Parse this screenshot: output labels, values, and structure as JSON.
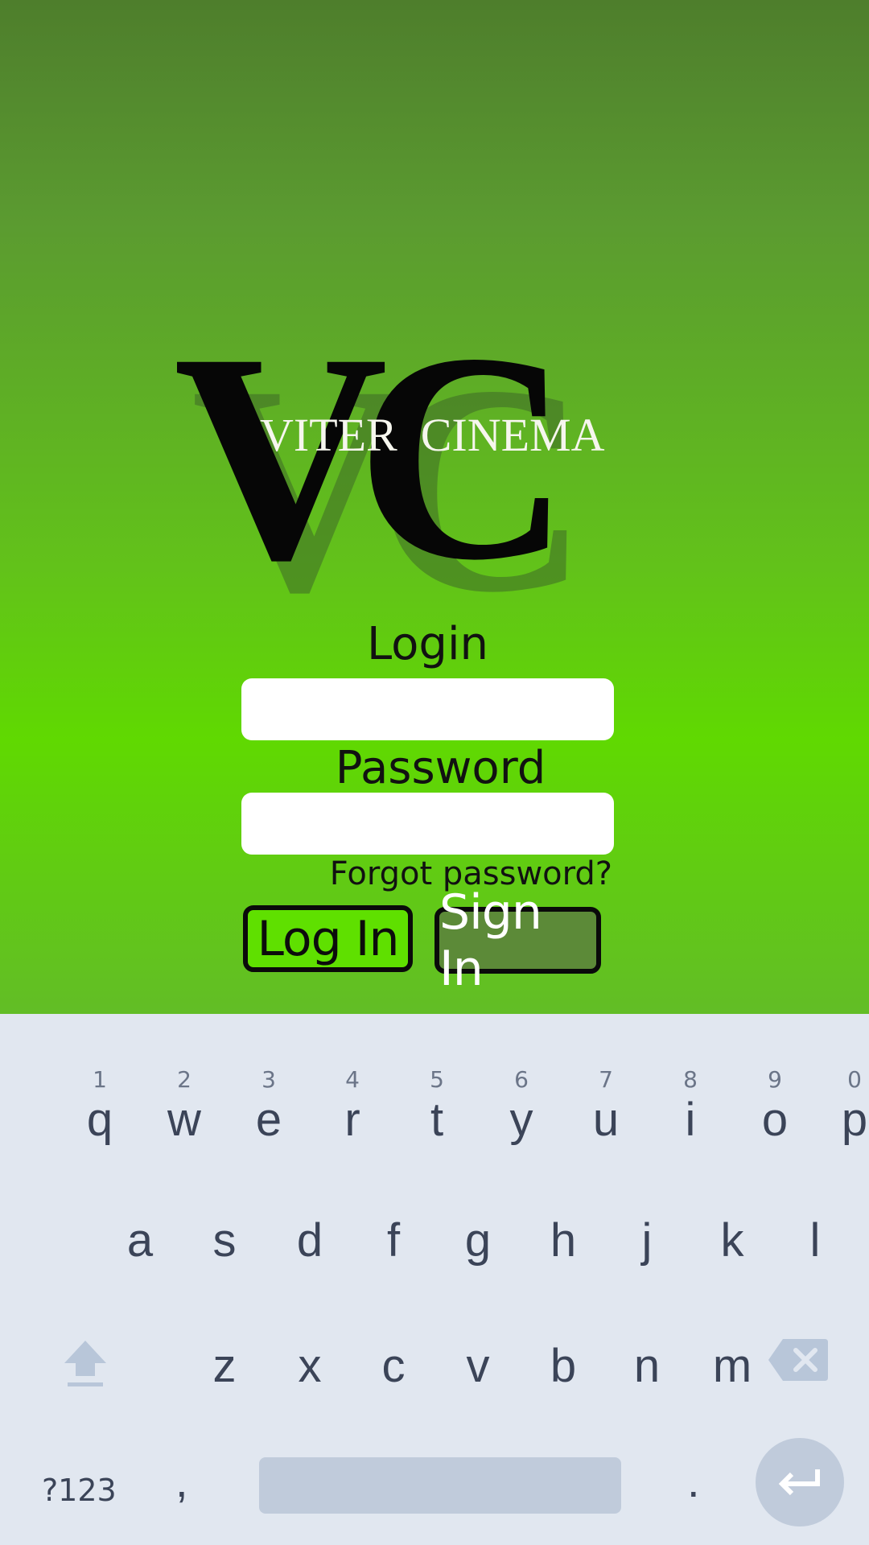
{
  "brand": {
    "monogram": "VC",
    "name": "VITER  CINEMA"
  },
  "form": {
    "login_label": "Login",
    "login_value": "",
    "password_label": "Password",
    "password_value": "",
    "forgot_label": "Forgot password?",
    "login_button": "Log In",
    "signin_button": "Sign In"
  },
  "keyboard": {
    "row1": [
      {
        "key": "q",
        "hint": "1"
      },
      {
        "key": "w",
        "hint": "2"
      },
      {
        "key": "e",
        "hint": "3"
      },
      {
        "key": "r",
        "hint": "4"
      },
      {
        "key": "t",
        "hint": "5"
      },
      {
        "key": "y",
        "hint": "6"
      },
      {
        "key": "u",
        "hint": "7"
      },
      {
        "key": "i",
        "hint": "8"
      },
      {
        "key": "o",
        "hint": "9"
      },
      {
        "key": "p",
        "hint": "0"
      }
    ],
    "row2": [
      "a",
      "s",
      "d",
      "f",
      "g",
      "h",
      "j",
      "k",
      "l"
    ],
    "row3": [
      "z",
      "x",
      "c",
      "v",
      "b",
      "n",
      "m"
    ],
    "symbols_label": "?123",
    "comma": ",",
    "period": ".",
    "icons": {
      "shift": "shift-icon",
      "backspace": "backspace-icon",
      "enter": "enter-icon"
    }
  },
  "colors": {
    "login_button_bg": "#5fe000",
    "signin_button_bg": "#5c8a38",
    "keyboard_bg": "#e1e7f0",
    "key_text": "#3b4458"
  }
}
